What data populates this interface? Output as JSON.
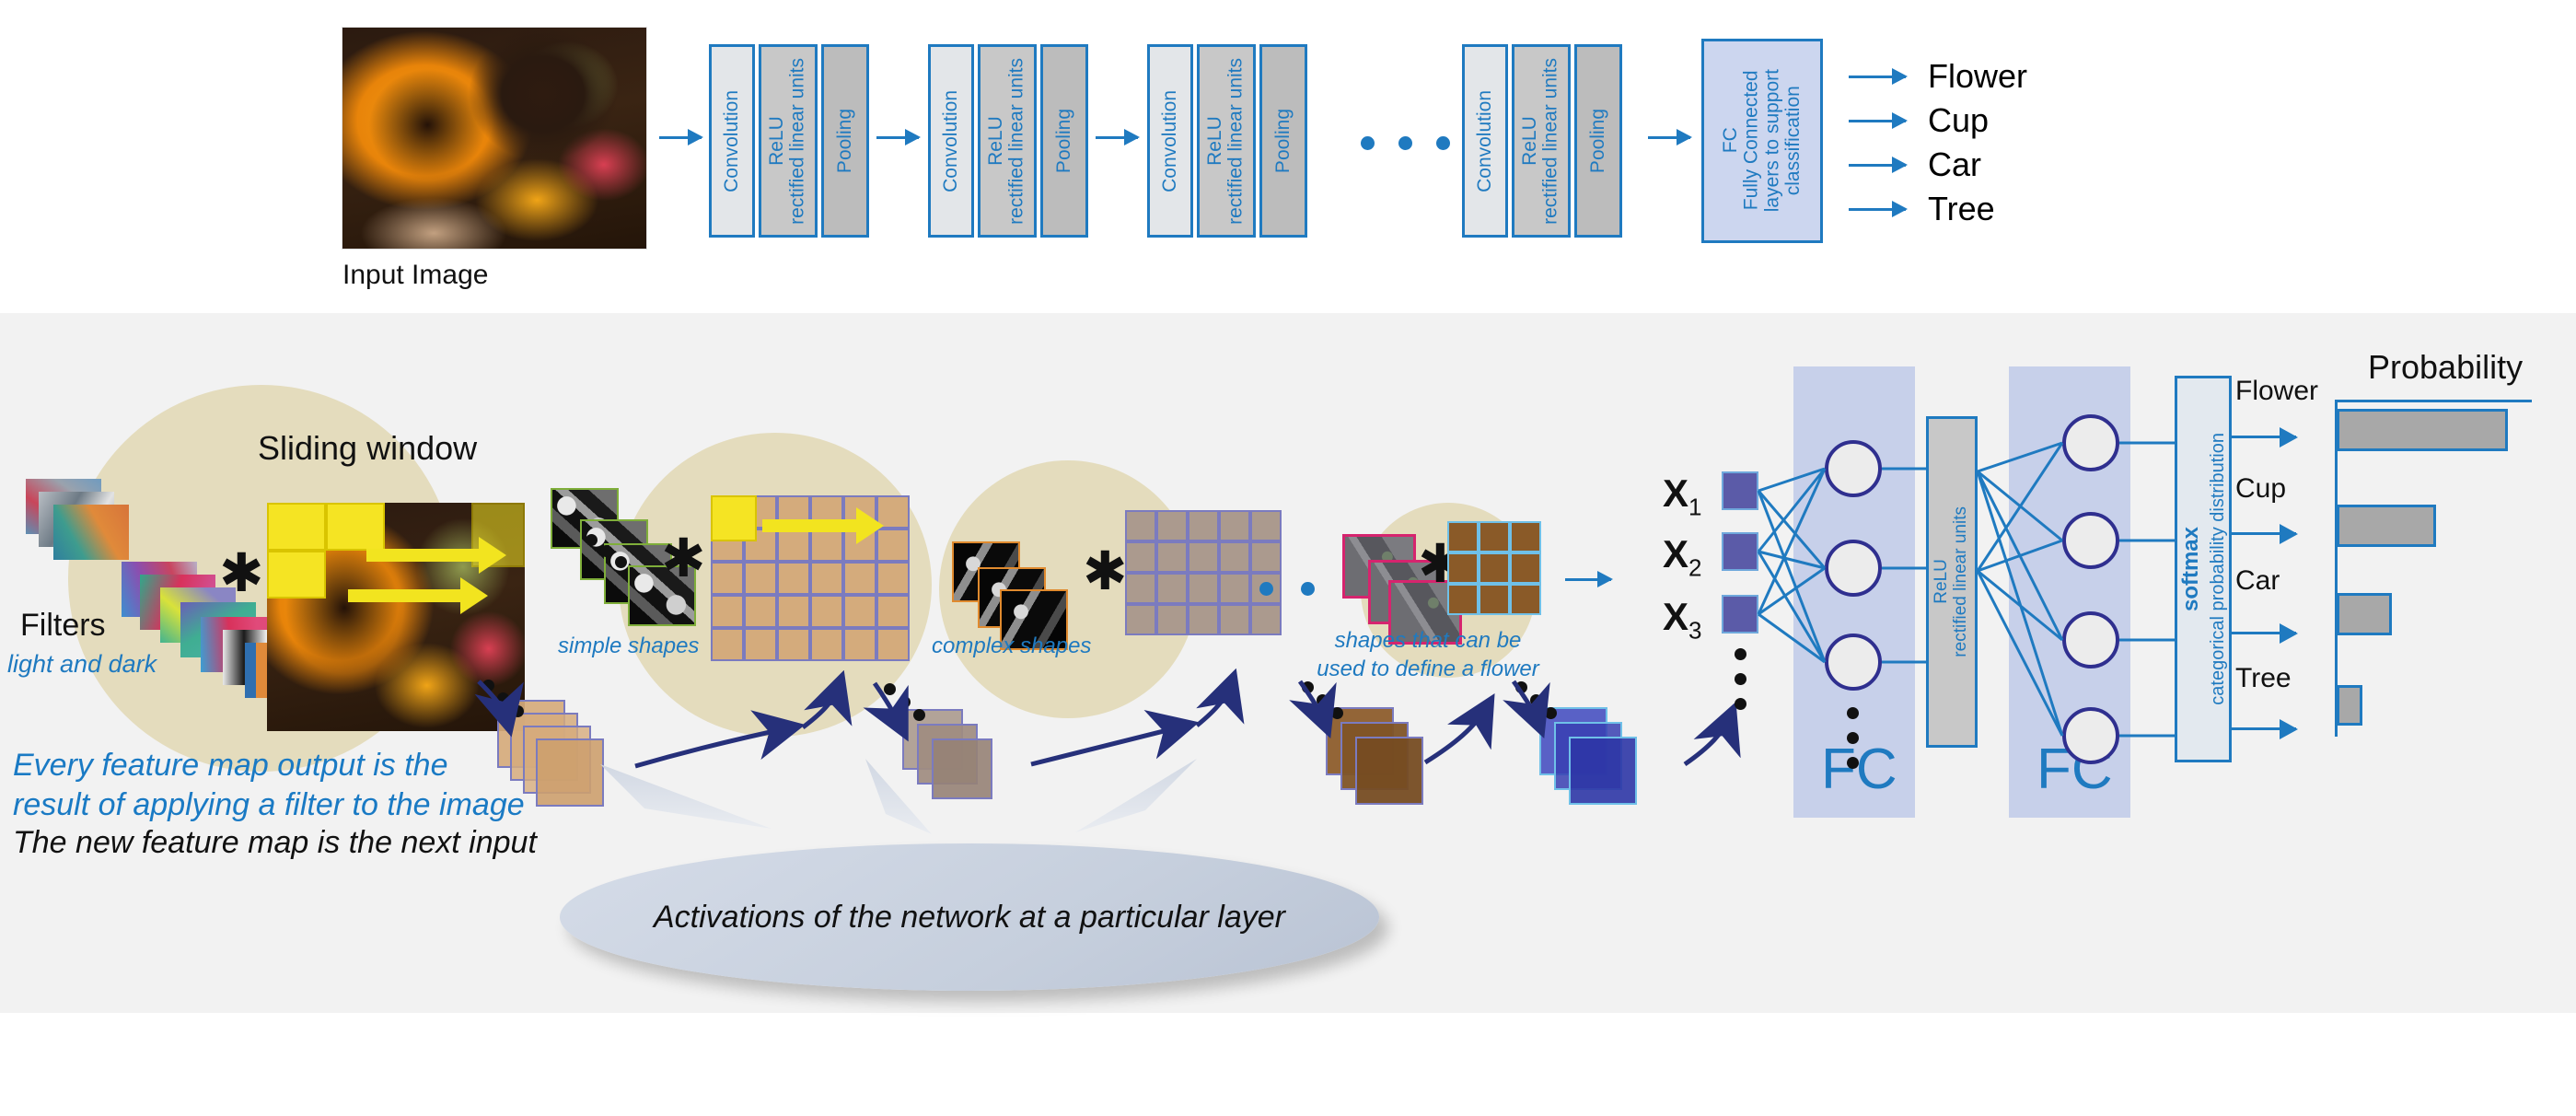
{
  "figure": {
    "top_pipeline": {
      "input_image_label": "Input Image",
      "blocks": [
        {
          "conv": "Convolution",
          "relu_line1": "ReLU",
          "relu_line2": "rectified linear units",
          "pool": "Pooling"
        },
        {
          "conv": "Convolution",
          "relu_line1": "ReLU",
          "relu_line2": "rectified linear units",
          "pool": "Pooling"
        },
        {
          "conv": "Convolution",
          "relu_line1": "ReLU",
          "relu_line2": "rectified linear units",
          "pool": "Pooling"
        },
        {
          "conv": "Convolution",
          "relu_line1": "ReLU",
          "relu_line2": "rectified linear units",
          "pool": "Pooling"
        }
      ],
      "fc_block": {
        "abbrev": "FC",
        "line1": "Fully Connected",
        "line2": "layers to support",
        "line3": "classification"
      },
      "outputs": [
        "Flower",
        "Cup",
        "Car",
        "Tree"
      ]
    },
    "bottom_detail": {
      "filters_label": "Filters",
      "filters_sub": "light and dark",
      "sliding_window": "Sliding window",
      "stage_labels": [
        "simple shapes",
        "complex shapes"
      ],
      "flower_caption_line1": "shapes that can be",
      "flower_caption_line2": "used to define a flower",
      "caption_blue_line1": "Every feature map output is the",
      "caption_blue_line2": "result of applying a filter to the image",
      "caption_black": "The new feature map is the next input",
      "ellipse_caption": "Activations of the network at a particular layer",
      "conv_operator": "✱",
      "inputs": [
        {
          "label": "X",
          "sub": "1"
        },
        {
          "label": "X",
          "sub": "2"
        },
        {
          "label": "X",
          "sub": "3"
        }
      ],
      "fc_label": "FC",
      "relu": {
        "line1": "ReLU",
        "line2": "rectified linear units"
      },
      "softmax": {
        "bold": "softmax",
        "sub": "categorical probability distribution"
      }
    },
    "colors": {
      "accent_blue": "#1f7ac0",
      "panel_top": "#ffffff",
      "panel_bottom": "#f2f2f2",
      "conv_fill": "#e3e6e9",
      "relu_fill": "#c8c8c8",
      "pool_fill": "#bcbcbc",
      "fc_fill": "#ccd6ef",
      "fc_band": "#c7d0ea",
      "blob_beige": "#e4dcbd",
      "bar_gray": "#a8a8a8",
      "neuron_border": "#2f2f8f",
      "highlight_yellow": "#f2e41f"
    }
  },
  "chart_data": {
    "type": "bar",
    "title": "Probability",
    "orientation": "horizontal",
    "categories": [
      "Flower",
      "Cup",
      "Car",
      "Tree"
    ],
    "values": [
      0.93,
      0.54,
      0.3,
      0.14
    ],
    "xlabel": "",
    "ylabel": "",
    "xlim": [
      0,
      1
    ],
    "grid": false,
    "legend": false
  }
}
